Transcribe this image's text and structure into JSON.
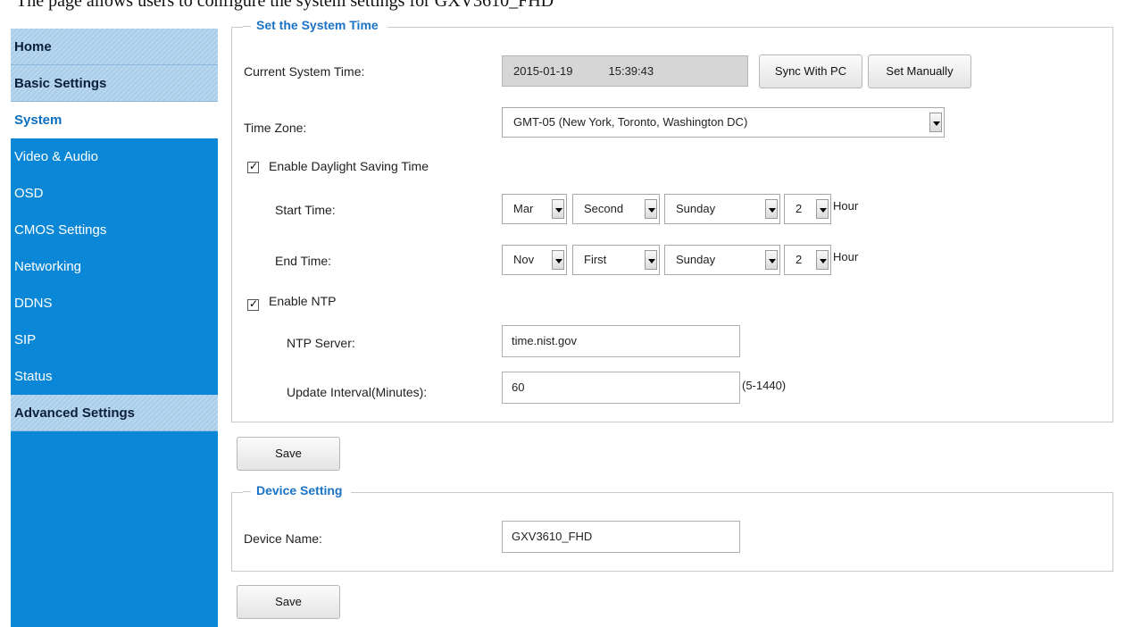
{
  "caption": "The page allows users to configure the system settings for GXV3610_FHD",
  "sidebar": {
    "items": [
      {
        "label": "Home",
        "type": "header"
      },
      {
        "label": "Basic Settings",
        "type": "header"
      },
      {
        "label": "System",
        "type": "active"
      },
      {
        "label": "Video & Audio",
        "type": "normal"
      },
      {
        "label": "OSD",
        "type": "normal"
      },
      {
        "label": "CMOS Settings",
        "type": "normal"
      },
      {
        "label": "Networking",
        "type": "normal"
      },
      {
        "label": "DDNS",
        "type": "normal"
      },
      {
        "label": "SIP",
        "type": "normal"
      },
      {
        "label": "Status",
        "type": "normal"
      },
      {
        "label": "Advanced Settings",
        "type": "header"
      }
    ]
  },
  "system_time": {
    "title": "Set the System Time",
    "current_label": "Current System Time:",
    "current_date": "2015-01-19",
    "current_time": "15:39:43",
    "sync_button": "Sync With PC",
    "set_manual_button": "Set Manually",
    "timezone_label": "Time Zone:",
    "timezone_value": "GMT-05 (New York, Toronto, Washington DC)",
    "dst_label": "Enable Daylight Saving Time",
    "dst_checked": true,
    "start_label": "Start Time:",
    "start": {
      "month": "Mar",
      "week": "Second",
      "day": "Sunday",
      "hour": "2"
    },
    "end_label": "End Time:",
    "end": {
      "month": "Nov",
      "week": "First",
      "day": "Sunday",
      "hour": "2"
    },
    "hour_unit": "Hour",
    "ntp_label": "Enable NTP",
    "ntp_checked": true,
    "ntp_server_label": "NTP Server:",
    "ntp_server_value": "time.nist.gov",
    "interval_label": "Update Interval(Minutes):",
    "interval_value": "60",
    "interval_hint": "(5-1440)"
  },
  "save_label": "Save",
  "device": {
    "title": "Device Setting",
    "name_label": "Device Name:",
    "name_value": "GXV3610_FHD"
  }
}
